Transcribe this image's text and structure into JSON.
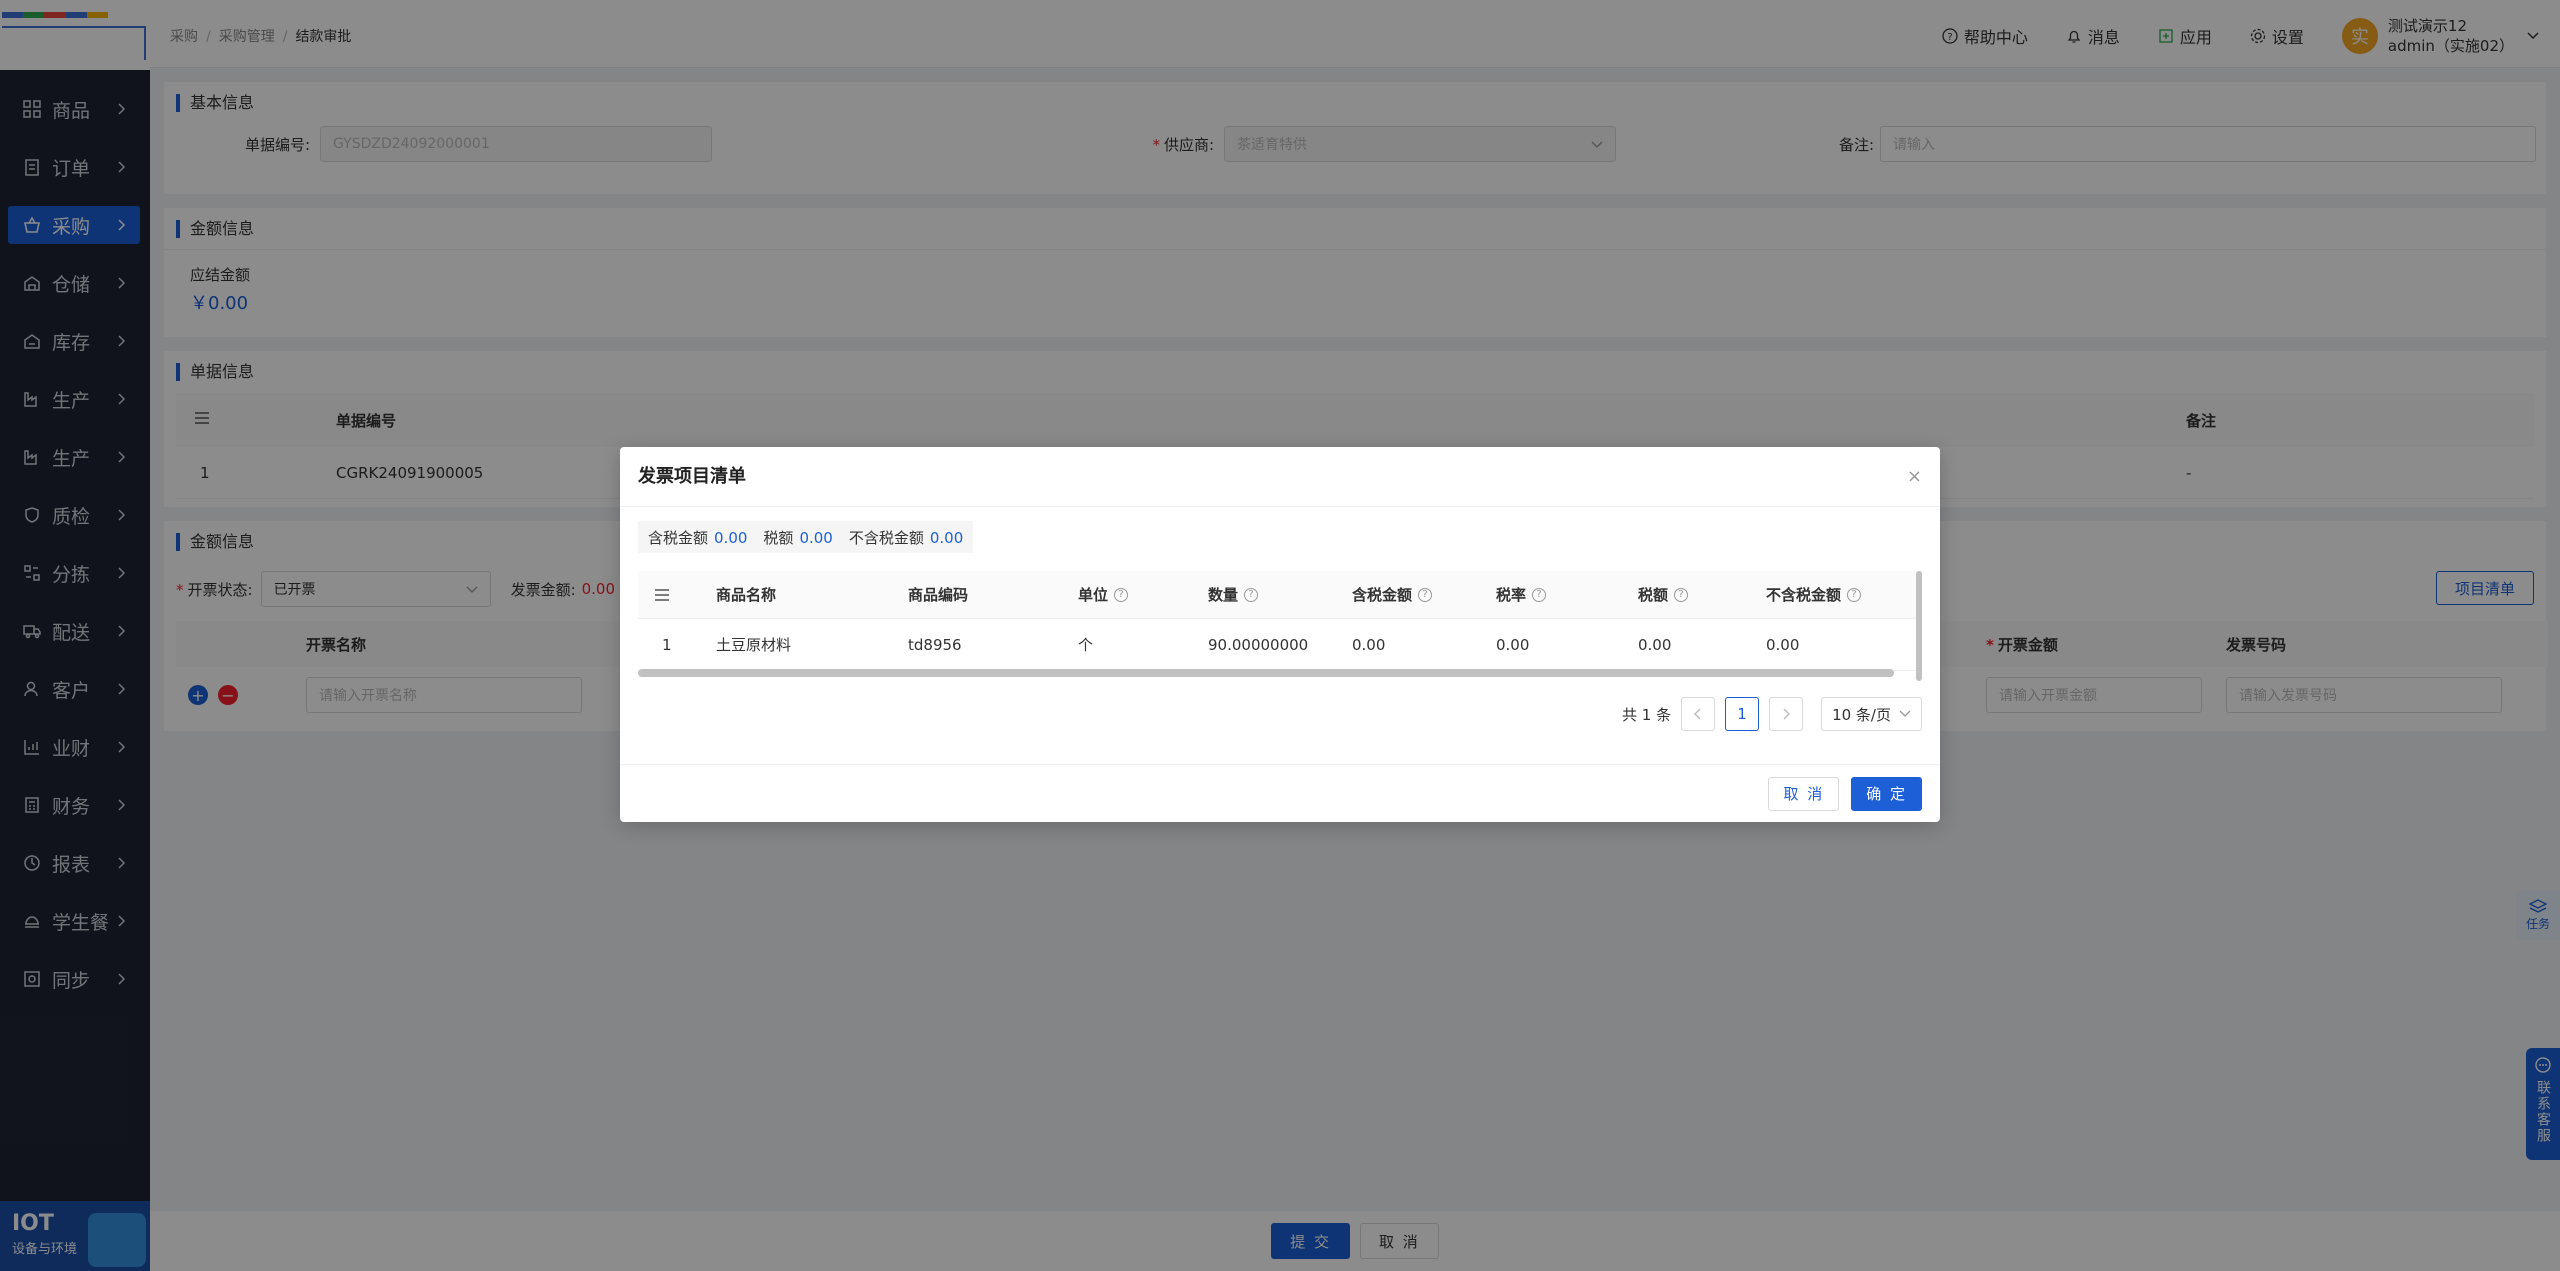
{
  "sidebar": {
    "items": [
      {
        "label": "商品",
        "icon": "grid-icon"
      },
      {
        "label": "订单",
        "icon": "clipboard-icon"
      },
      {
        "label": "采购",
        "icon": "basket-icon",
        "active": true
      },
      {
        "label": "仓储",
        "icon": "warehouse-icon"
      },
      {
        "label": "库存",
        "icon": "inventory-icon"
      },
      {
        "label": "生产",
        "icon": "factory-icon"
      },
      {
        "label": "生产",
        "icon": "factory-icon"
      },
      {
        "label": "质检",
        "icon": "shield-icon"
      },
      {
        "label": "分拣",
        "icon": "sort-icon"
      },
      {
        "label": "配送",
        "icon": "truck-icon"
      },
      {
        "label": "客户",
        "icon": "user-icon"
      },
      {
        "label": "业财",
        "icon": "chart-icon"
      },
      {
        "label": "财务",
        "icon": "calculator-icon"
      },
      {
        "label": "报表",
        "icon": "report-icon"
      },
      {
        "label": "学生餐",
        "icon": "meal-icon"
      },
      {
        "label": "同步",
        "icon": "sync-icon"
      }
    ],
    "iot": {
      "title": "IOT",
      "subtitle": "设备与环境"
    }
  },
  "header": {
    "breadcrumb": [
      "采购",
      "采购管理",
      "结款审批"
    ],
    "actions": {
      "help": "帮助中心",
      "messages": "消息",
      "apps": "应用",
      "settings": "设置"
    },
    "user": {
      "avatar": "实",
      "name": "测试演示12",
      "account": "admin（实施02）"
    }
  },
  "basic": {
    "title": "基本信息",
    "doc_no_label": "单据编号:",
    "doc_no_value": "GYSDZD24092000001",
    "supplier_label": "供应商:",
    "supplier_value": "茶适育特供",
    "remark_label": "备注:",
    "remark_placeholder": "请输入"
  },
  "amount": {
    "title": "金额信息",
    "label": "应结金额",
    "value": "￥0.00"
  },
  "docs": {
    "title": "单据信息",
    "col_no": "单据编号",
    "col_remark": "备注",
    "row_index": "1",
    "row_no": "CGRK24091900005",
    "row_remark": "-"
  },
  "invoice": {
    "title": "金额信息",
    "status_label": "开票状态:",
    "status_value": "已开票",
    "amount_label": "发票金额:",
    "amount_value": "0.00",
    "items_button": "项目清单",
    "col_name": "开票名称",
    "col_amount": "开票金额",
    "col_number": "发票号码",
    "name_placeholder": "请输入开票名称",
    "amount_placeholder": "请输入开票金额",
    "number_placeholder": "请输入发票号码"
  },
  "footer": {
    "submit": "提 交",
    "cancel": "取 消"
  },
  "floating": {
    "task": "任务",
    "cs": "联系客服"
  },
  "modal": {
    "title": "发票项目清单",
    "summary": [
      {
        "label": "含税金额",
        "value": "0.00"
      },
      {
        "label": "税额",
        "value": "0.00"
      },
      {
        "label": "不含税金额",
        "value": "0.00"
      }
    ],
    "columns": [
      "商品名称",
      "商品编码",
      "单位",
      "数量",
      "含税金额",
      "税率",
      "税额",
      "不含税金额"
    ],
    "rows": [
      {
        "index": "1",
        "name": "土豆原材料",
        "code": "td8956",
        "unit": "个",
        "qty": "90.00000000",
        "taxed": "0.00",
        "rate": "0.00",
        "tax": "0.00",
        "untaxed": "0.00"
      }
    ],
    "pager": {
      "total": "共 1 条",
      "page": "1",
      "size": "10 条/页"
    },
    "cancel": "取 消",
    "confirm": "确 定"
  },
  "colors": {
    "primary": "#1d5fd6",
    "sidebar": "#1f2433",
    "danger": "#f5222d"
  }
}
